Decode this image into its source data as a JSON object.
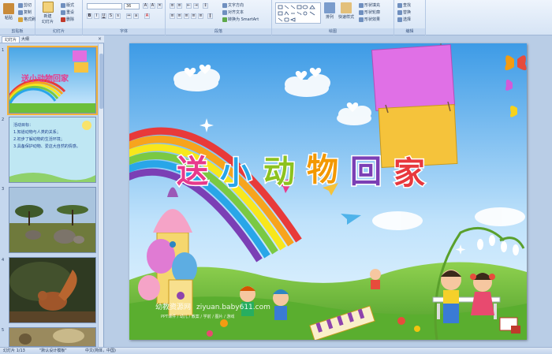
{
  "ribbon": {
    "groups": [
      {
        "label": "剪贴板"
      },
      {
        "label": "幻灯片"
      },
      {
        "label": "字体"
      },
      {
        "label": "段落"
      },
      {
        "label": "绘图"
      },
      {
        "label": "编辑"
      }
    ],
    "clipboard": {
      "paste": "粘贴",
      "cut": "剪切",
      "copy": "复制",
      "format_painter": "格式刷"
    },
    "slides": {
      "new_slide": "新建\n幻灯片",
      "layout": "版式",
      "reset": "重设",
      "delete": "删除"
    },
    "font": {
      "font_size": "36"
    },
    "paragraph": {
      "text_direction": "文字方向",
      "align_text": "对齐文本",
      "smartart": "转换为 SmartArt"
    },
    "drawing": {
      "arrange": "排列",
      "quick_styles": "快速样式",
      "shape_fill": "形状填充",
      "shape_outline": "形状轮廓",
      "shape_effects": "形状效果"
    },
    "editing": {
      "find": "查找",
      "replace": "替换",
      "select": "选择"
    }
  },
  "panel": {
    "tabs": [
      "幻灯片",
      "大纲"
    ],
    "close": "×",
    "slides": [
      {
        "number": "1",
        "title": "送小动物回家"
      },
      {
        "number": "2",
        "heading": "活动目标：",
        "lines": [
          "1.知道动物与人类的关系；",
          "2.初步了解动物的生活环境；",
          "3.具备保护动物、爱这大自然的情感。"
        ]
      },
      {
        "number": "3"
      },
      {
        "number": "4"
      },
      {
        "number": "5"
      }
    ]
  },
  "slide": {
    "title_chars": [
      "送",
      "小",
      "动",
      "物",
      "回",
      "家"
    ],
    "title_colors": [
      "#e83a8c",
      "#29a6e8",
      "#8dc21f",
      "#f39800",
      "#7b3fb5",
      "#e8383d"
    ],
    "watermark_site": "幼教资源网",
    "watermark_url": "ziyuan.baby611.com",
    "watermark_sub": "PPT课件 / 幼儿 / 教案 / 学前 / 图片 / 游戏"
  },
  "status": {
    "slide_counter": "幻灯片 1/13",
    "theme": "\"默认设计模板\"",
    "language": "中文(简体，中国)"
  }
}
